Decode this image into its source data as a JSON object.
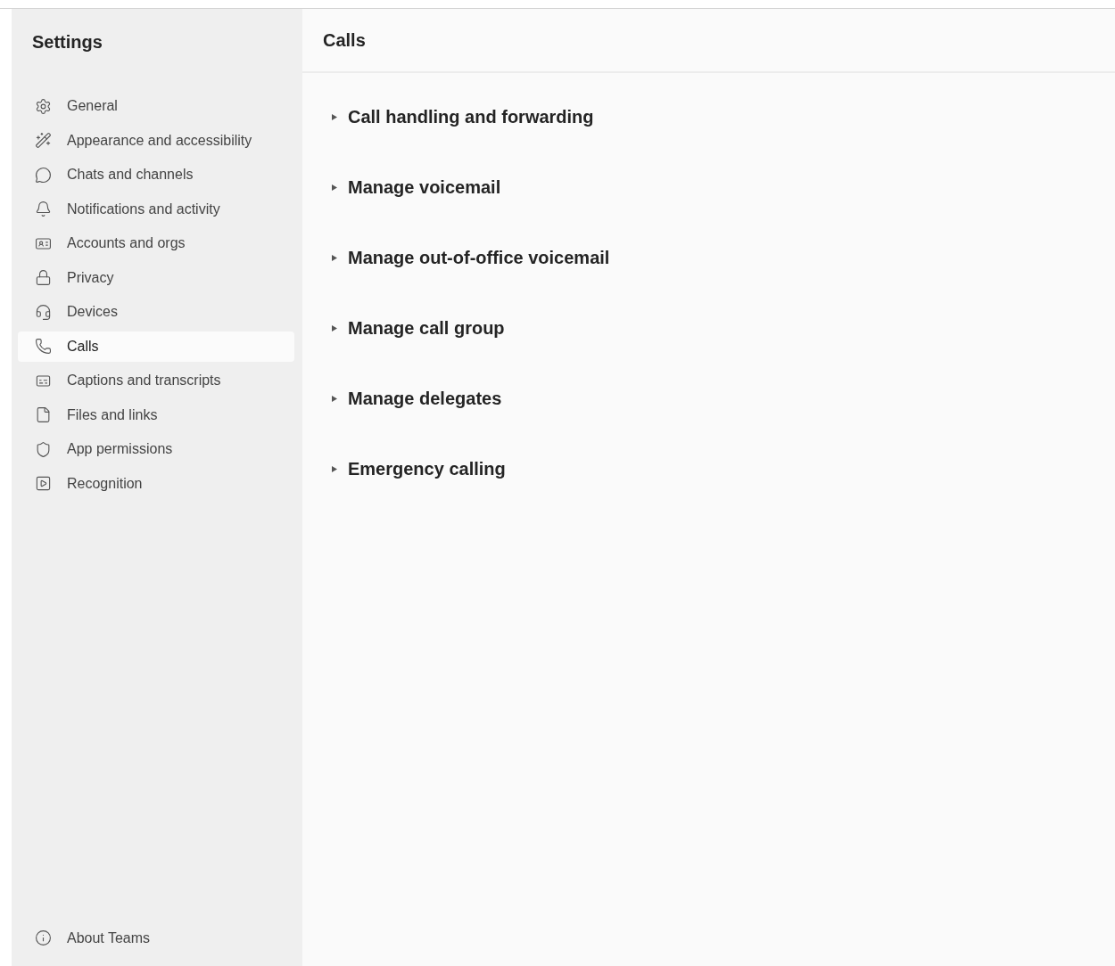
{
  "sidebar": {
    "title": "Settings",
    "items": [
      {
        "label": "General",
        "selected": false
      },
      {
        "label": "Appearance and accessibility",
        "selected": false
      },
      {
        "label": "Chats and channels",
        "selected": false
      },
      {
        "label": "Notifications and activity",
        "selected": false
      },
      {
        "label": "Accounts and orgs",
        "selected": false
      },
      {
        "label": "Privacy",
        "selected": false
      },
      {
        "label": "Devices",
        "selected": false
      },
      {
        "label": "Calls",
        "selected": true
      },
      {
        "label": "Captions and transcripts",
        "selected": false
      },
      {
        "label": "Files and links",
        "selected": false
      },
      {
        "label": "App permissions",
        "selected": false
      },
      {
        "label": "Recognition",
        "selected": false
      }
    ],
    "footer": {
      "label": "About Teams"
    }
  },
  "main": {
    "title": "Calls",
    "sections": [
      {
        "label": "Call handling and forwarding",
        "expanded": false
      },
      {
        "label": "Manage voicemail",
        "expanded": false
      },
      {
        "label": "Manage out-of-office voicemail",
        "expanded": false
      },
      {
        "label": "Manage call group",
        "expanded": false
      },
      {
        "label": "Manage delegates",
        "expanded": false
      },
      {
        "label": "Emergency calling",
        "expanded": false
      }
    ]
  }
}
